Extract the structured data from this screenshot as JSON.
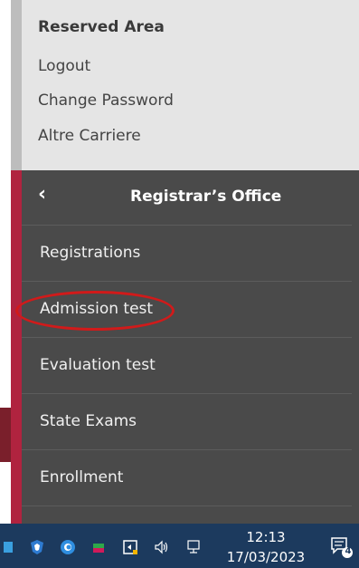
{
  "reserved_area": {
    "title": "Reserved Area",
    "links": [
      "Logout",
      "Change Password",
      "Altre Carriere"
    ]
  },
  "menu": {
    "back_icon": "chevron-left-icon",
    "title": "Registrar’s Office",
    "items": [
      "Registrations",
      "Admission test",
      "Evaluation test",
      "State Exams",
      "Enrollment"
    ],
    "highlighted_item": "Admission test"
  },
  "taskbar": {
    "time": "12:13",
    "date": "17/03/2023",
    "notification_count": "4",
    "icons": [
      "app-icon",
      "shield-icon",
      "browser-icon",
      "bookstack-icon",
      "screen-capture-icon",
      "speaker-icon",
      "network-icon",
      "notification-icon"
    ]
  },
  "colors": {
    "menu_bg": "#4a4a4a",
    "reserved_bg": "#e5e5e5",
    "accent_red": "#b0233f",
    "annotation_red": "#d11a1a",
    "taskbar_bg": "#1c3a5e"
  }
}
